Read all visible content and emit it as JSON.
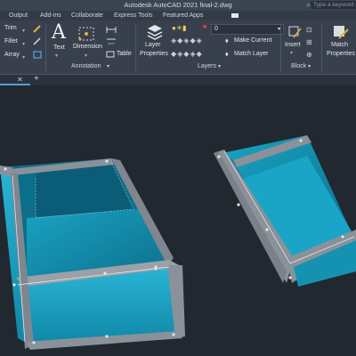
{
  "window": {
    "title": "Autodesk AutoCAD 2021   final-2.dwg",
    "search_placeholder": "Type a keyword or"
  },
  "menu_tabs": [
    "Output",
    "Add-ins",
    "Collaborate",
    "Express Tools",
    "Featured Apps"
  ],
  "modify": {
    "trim": "Trim",
    "fillet": "Fillet",
    "array": "Array"
  },
  "annotation": {
    "text": "Text",
    "dimension": "Dimension",
    "table": "Table",
    "panel": "Annotation"
  },
  "layers": {
    "layer_properties": "Layer Properties",
    "current_layer": "0",
    "make_current": "Make Current",
    "match_layer": "Match Layer",
    "panel": "Layers"
  },
  "block": {
    "insert": "Insert",
    "panel": "Block"
  },
  "match_properties": "Match Properties",
  "colors": {
    "ribbon": "#38404d",
    "viewport": "#212830",
    "glass": "#0f8fae",
    "frame": "#8a9199"
  }
}
